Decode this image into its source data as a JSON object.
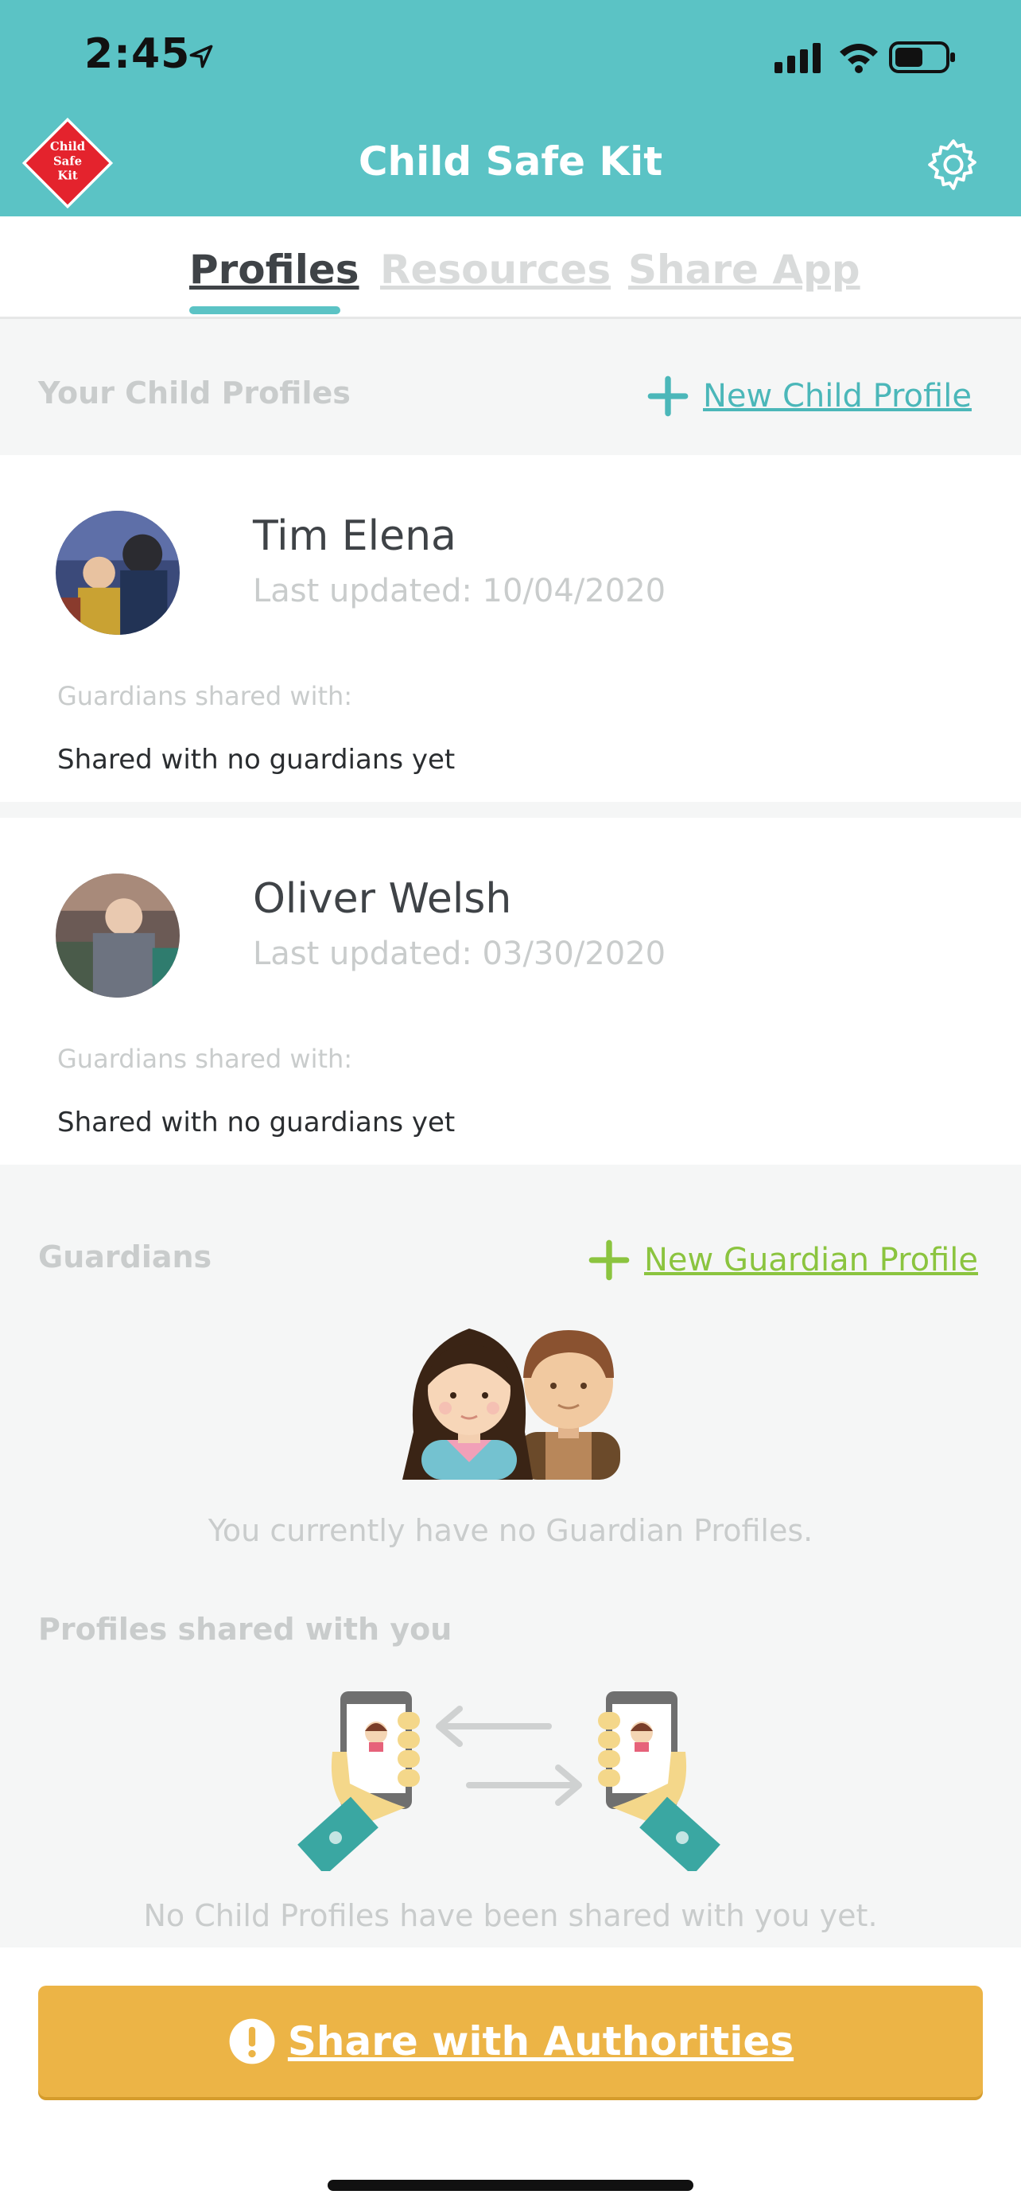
{
  "status_bar": {
    "time": "2:45",
    "icons": [
      "location-arrow-icon",
      "cellular-signal-icon",
      "wifi-icon",
      "battery-icon"
    ]
  },
  "header": {
    "logo_text": [
      "Child",
      "Safe",
      "Kit"
    ],
    "title": "Child Safe Kit",
    "settings_icon": "gear-icon"
  },
  "tabs": [
    {
      "label": "Profiles",
      "active": true
    },
    {
      "label": "Resources",
      "active": false
    },
    {
      "label": "Share App",
      "active": false
    }
  ],
  "child_profiles": {
    "section_label": "Your Child Profiles",
    "new_label": "New Child Profile",
    "items": [
      {
        "name": "Tim Elena",
        "last_updated": "Last updated: 10/04/2020",
        "guardians_label": "Guardians shared with:",
        "guardians_value": "Shared with no guardians yet"
      },
      {
        "name": "Oliver Welsh",
        "last_updated": "Last updated: 03/30/2020",
        "guardians_label": "Guardians shared with:",
        "guardians_value": "Shared with no guardians yet"
      }
    ]
  },
  "guardians": {
    "section_label": "Guardians",
    "new_label": "New Guardian Profile",
    "empty_text": "You currently have no Guardian Profiles."
  },
  "shared": {
    "section_label": "Profiles shared with you",
    "empty_text": "No Child Profiles have been shared with you yet."
  },
  "authorities_button": {
    "label": "Share with Authorities"
  },
  "colors": {
    "brand_teal": "#5bc3c5",
    "link_teal": "#4bb7b9",
    "guardian_green": "#8bc43f",
    "authorities_yellow": "#ecb446"
  }
}
